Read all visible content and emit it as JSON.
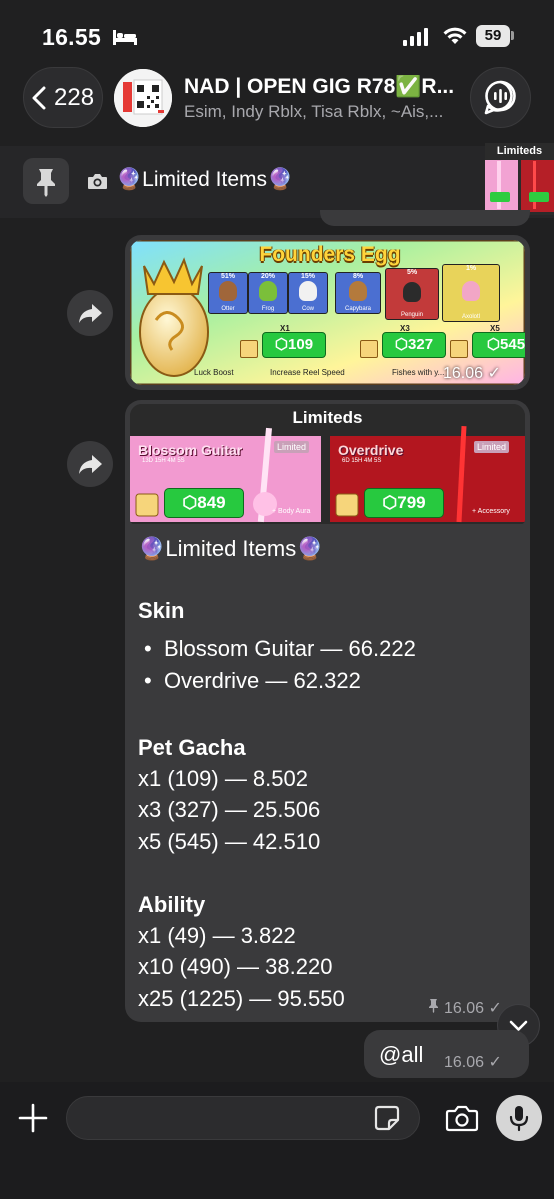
{
  "status": {
    "time": "16.55",
    "battery": "59"
  },
  "header": {
    "back_count": "228",
    "title": "NAD | OPEN GIG R78✅R...",
    "subtitle": "Esim, Indy Rblx, Tisa Rblx, ~Ais,..."
  },
  "pinned": {
    "text": "🔮Limited Items🔮",
    "thumb_label": "Limiteds"
  },
  "message1": {
    "image": {
      "title": "Founders Egg",
      "pets": [
        {
          "pct": "51%",
          "name": "Otter"
        },
        {
          "pct": "20%",
          "name": "Frog"
        },
        {
          "pct": "15%",
          "name": "Cow"
        },
        {
          "pct": "8%",
          "name": "Capybara"
        },
        {
          "pct": "5%",
          "name": "Penguin"
        },
        {
          "pct": "1%",
          "name": "Axolotl"
        }
      ],
      "prices": [
        {
          "mult": "X1",
          "value": "109"
        },
        {
          "mult": "X3",
          "value": "327"
        },
        {
          "mult": "X5",
          "value": "545"
        }
      ],
      "perks": [
        "Luck Boost",
        "Increase Reel Speed",
        "Fishes with y..."
      ]
    },
    "time": "16.06 ✓"
  },
  "message2": {
    "image": {
      "title": "Limiteds",
      "items": [
        {
          "name": "Blossom Guitar",
          "timer": "13D 15H 4M 5S",
          "badge": "Limited",
          "price": "849",
          "tag": "+ Body Aura"
        },
        {
          "name": "Overdrive",
          "timer": "6D 15H 4M 5S",
          "badge": "Limited",
          "price": "799",
          "tag": "+ Accessory"
        }
      ]
    },
    "heading": "🔮Limited Items🔮",
    "skin_title": "Skin",
    "skin_items": [
      "Blossom Guitar — 66.222",
      "Overdrive — 62.322"
    ],
    "gacha_title": "Pet Gacha",
    "gacha_lines": [
      "x1 (109) — 8.502",
      "x3 (327) — 25.506",
      "x5 (545) — 42.510"
    ],
    "ability_title": "Ability",
    "ability_lines": [
      "x1 (49) — 3.822",
      "x10 (490) — 38.220",
      "x25 (1225) — 95.550"
    ],
    "time": "16.06 ✓"
  },
  "message3": {
    "text": "@all",
    "time": "16.06 ✓"
  },
  "composer": {
    "placeholder": ""
  },
  "colors": {
    "background": "#202021",
    "bubble": "#3a3a3c",
    "accent": "#4cd964"
  }
}
